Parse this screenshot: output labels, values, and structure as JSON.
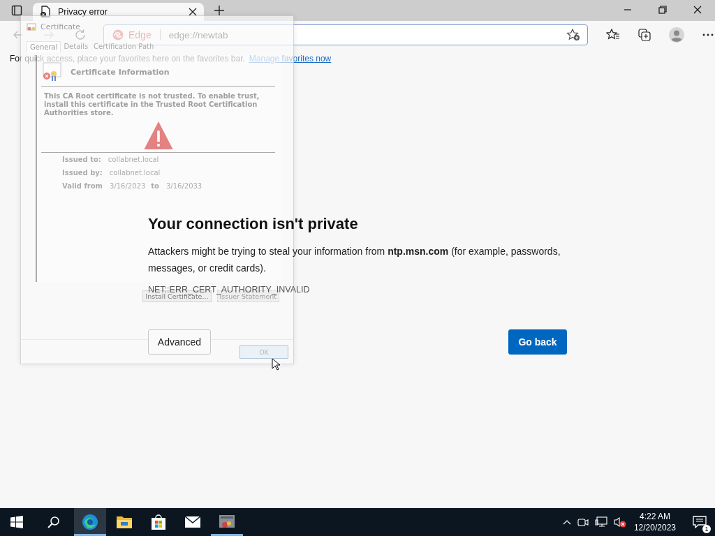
{
  "browser_tabs": [
    {
      "title": "Privacy error",
      "selected": true
    }
  ],
  "address_bar": {
    "site_label": "Edge",
    "url": "edge://newtab"
  },
  "favorites_bar": {
    "text": "For quick access, place your favorites here on the favorites bar.",
    "link": "Manage favorites now"
  },
  "error_page": {
    "heading": "Your connection isn't private",
    "message": "Attackers might be trying to steal your information from **ntp.msn.com** (for example, passwords, messages, or credit cards).",
    "error_code": "NET::ERR_CERT_AUTHORITY_INVALID",
    "buttons": [
      {
        "label": "Advanced",
        "kind": "secondary"
      },
      {
        "label": "Go back",
        "kind": "primary"
      }
    ]
  },
  "certificate_dialog": {
    "title": "Certificate",
    "tabs": [
      {
        "label": "General",
        "selected": true
      },
      {
        "label": "Details",
        "selected": false
      },
      {
        "label": "Certification Path",
        "selected": false
      }
    ],
    "info_title": "Certificate Information",
    "warning": "This CA Root certificate is not trusted. To enable trust, install this certificate in the Trusted Root Certification Authorities store.",
    "fields": [
      {
        "label": "Issued to:",
        "value": "collabnet.local"
      },
      {
        "label": "Issued by:",
        "value": "collabnet.local"
      }
    ],
    "validity": {
      "label": "Valid from",
      "from": "3/16/2023",
      "to_label": "to",
      "to": "3/16/2033"
    },
    "buttons": [
      {
        "label": "Install Certificate...",
        "disabled": false
      },
      {
        "label": "Issuer Statement",
        "disabled": true
      }
    ],
    "ok_label": "OK"
  },
  "taskbar": {
    "apps": [
      {
        "kind": "edge",
        "selected": true,
        "open": true
      },
      {
        "kind": "explorer",
        "selected": false,
        "open": false
      },
      {
        "kind": "store",
        "selected": false,
        "open": false
      },
      {
        "kind": "mail",
        "selected": false,
        "open": false
      },
      {
        "kind": "certmgr",
        "selected": false,
        "open": true
      }
    ],
    "clock": {
      "time": "4:22 AM",
      "date": "12/20/2023"
    },
    "notification_count": "1"
  }
}
